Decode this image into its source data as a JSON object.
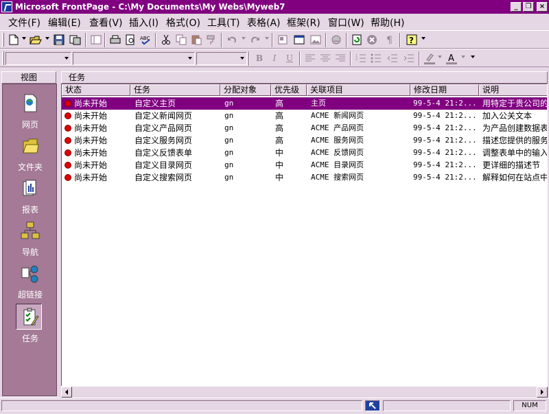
{
  "window": {
    "title": "Microsoft FrontPage - C:\\My Documents\\My Webs\\Myweb7",
    "minimize_label": "_",
    "restore_label": "❐",
    "close_label": "×"
  },
  "menu": [
    {
      "label": "文件(F)"
    },
    {
      "label": "编辑(E)"
    },
    {
      "label": "查看(V)"
    },
    {
      "label": "插入(I)"
    },
    {
      "label": "格式(O)"
    },
    {
      "label": "工具(T)"
    },
    {
      "label": "表格(A)"
    },
    {
      "label": "框架(R)"
    },
    {
      "label": "窗口(W)"
    },
    {
      "label": "帮助(H)"
    }
  ],
  "format_toolbar": {
    "bold": "B",
    "italic": "I",
    "underline": "U"
  },
  "views": {
    "header": "视图",
    "items": [
      {
        "label": "网页",
        "icon": "page-icon"
      },
      {
        "label": "文件夹",
        "icon": "folder-icon"
      },
      {
        "label": "报表",
        "icon": "reports-icon"
      },
      {
        "label": "导航",
        "icon": "navigation-icon"
      },
      {
        "label": "超链接",
        "icon": "hyperlinks-icon"
      },
      {
        "label": "任务",
        "icon": "tasks-icon"
      }
    ],
    "selected": "任务"
  },
  "tasks": {
    "header": "任务",
    "columns": [
      "状态",
      "任务",
      "分配对象",
      "优先级",
      "关联项目",
      "修改日期",
      "说明"
    ],
    "rows": [
      {
        "status": "尚未开始",
        "task": "自定义主页",
        "assigned": "gn",
        "priority": "高",
        "linked": "主页",
        "modified": "99-5-4 21:2...",
        "description": "用特定于贵公司的"
      },
      {
        "status": "尚未开始",
        "task": "自定义新闻网页",
        "assigned": "gn",
        "priority": "高",
        "linked": "ACME 新闻网页",
        "modified": "99-5-4 21:2...",
        "description": "加入公关文本"
      },
      {
        "status": "尚未开始",
        "task": "自定义产品网页",
        "assigned": "gn",
        "priority": "高",
        "linked": "ACME 产品网页",
        "modified": "99-5-4 21:2...",
        "description": "为产品创建数据表"
      },
      {
        "status": "尚未开始",
        "task": "自定义服务网页",
        "assigned": "gn",
        "priority": "高",
        "linked": "ACME 服务网页",
        "modified": "99-5-4 21:2...",
        "description": "描述您提供的服务"
      },
      {
        "status": "尚未开始",
        "task": "自定义反馈表单",
        "assigned": "gn",
        "priority": "中",
        "linked": "ACME 反馈网页",
        "modified": "99-5-4 21:2...",
        "description": "调整表单中的输入"
      },
      {
        "status": "尚未开始",
        "task": "自定义目录网页",
        "assigned": "gn",
        "priority": "中",
        "linked": "ACME 目录网页",
        "modified": "99-5-4 21:2...",
        "description": "更详细的描述节"
      },
      {
        "status": "尚未开始",
        "task": "自定义搜索网页",
        "assigned": "gn",
        "priority": "中",
        "linked": "ACME 搜索网页",
        "modified": "99-5-4 21:2...",
        "description": "解释如何在站点中"
      }
    ]
  },
  "status": {
    "num": "NUM"
  },
  "colors": {
    "title_bar": "#800080",
    "selection": "#800080",
    "view_bar": "#a47a96",
    "chrome": "#e6d7e4",
    "status_dot": "#e00000"
  }
}
